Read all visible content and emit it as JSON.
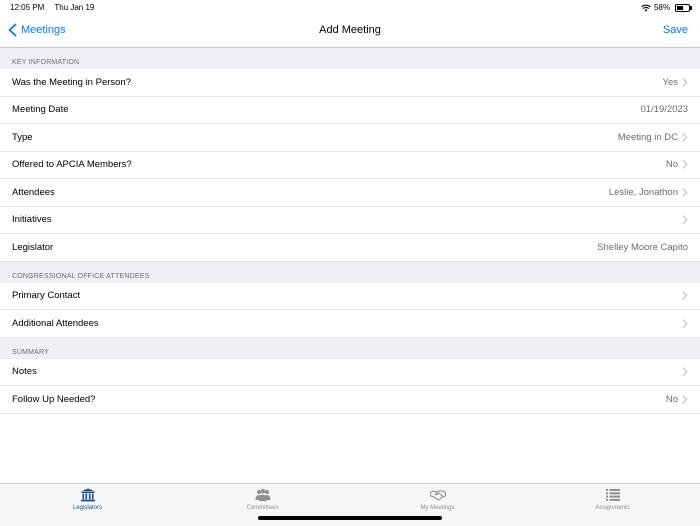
{
  "status_bar": {
    "time": "12:05 PM",
    "date": "Thu Jan 19",
    "battery_percent_text": "58%",
    "battery_level": 0.58,
    "wifi_icon": "wifi-icon"
  },
  "nav": {
    "back_label": "Meetings",
    "title": "Add Meeting",
    "save_label": "Save"
  },
  "sections": [
    {
      "header": "KEY INFORMATION",
      "rows": [
        {
          "label": "Was the Meeting in Person?",
          "value": "Yes",
          "chevron": true
        },
        {
          "label": "Meeting Date",
          "value": "01/19/2023",
          "chevron": false
        },
        {
          "label": "Type",
          "value": "Meeting in DC",
          "chevron": true
        },
        {
          "label": "Offered to APCIA Members?",
          "value": "No",
          "chevron": true
        },
        {
          "label": "Attendees",
          "value": "Leslie, Jonathon",
          "chevron": true
        },
        {
          "label": "Initiatives",
          "value": "",
          "chevron": true
        },
        {
          "label": "Legislator",
          "value": "Shelley Moore Capito",
          "chevron": false
        }
      ]
    },
    {
      "header": "CONGRESSIONAL OFFICE ATTENDEES",
      "rows": [
        {
          "label": "Primary Contact",
          "value": "",
          "chevron": true
        },
        {
          "label": "Additional Attendees",
          "value": "",
          "chevron": true
        }
      ]
    },
    {
      "header": "SUMMARY",
      "rows": [
        {
          "label": "Notes",
          "value": "",
          "chevron": true
        },
        {
          "label": "Follow Up Needed?",
          "value": "No",
          "chevron": true
        }
      ]
    }
  ],
  "tabs": [
    {
      "label": "Legislators",
      "icon": "capitol-building-icon",
      "active": true
    },
    {
      "label": "Committees",
      "icon": "group-people-icon",
      "active": false
    },
    {
      "label": "My Meetings",
      "icon": "handshake-icon",
      "active": false
    },
    {
      "label": "Assignments",
      "icon": "list-icon",
      "active": false
    }
  ],
  "colors": {
    "accent": "#007aff",
    "active_tab": "#1f4e8c",
    "inactive_tab": "#8e8e93",
    "section_bg": "#efeff4"
  }
}
